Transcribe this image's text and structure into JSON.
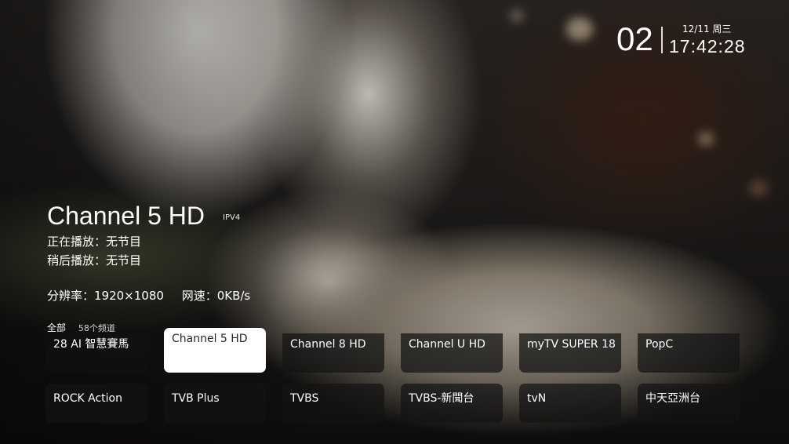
{
  "clock": {
    "channel_number": "02",
    "date": "12/11 周三",
    "time": "17:42:28"
  },
  "channel": {
    "name": "Channel 5 HD",
    "protocol": "IPV4",
    "now_playing": "正在播放：无节目",
    "up_next": "稍后播放：无节目",
    "resolution": "分辨率：1920×1080",
    "speed": "网速：0KB/s"
  },
  "list": {
    "group": "全部",
    "count": "58个频道",
    "selected_index": 1,
    "items": [
      {
        "label": "28 AI 智慧賽馬"
      },
      {
        "label": "Channel 5 HD"
      },
      {
        "label": "Channel 8 HD"
      },
      {
        "label": "Channel U HD"
      },
      {
        "label": "myTV SUPER 18"
      },
      {
        "label": "PopC"
      },
      {
        "label": "ROCK Action"
      },
      {
        "label": "TVB Plus"
      },
      {
        "label": "TVBS"
      },
      {
        "label": "TVBS-新聞台"
      },
      {
        "label": "tvN"
      },
      {
        "label": "中天亞洲台"
      }
    ]
  }
}
